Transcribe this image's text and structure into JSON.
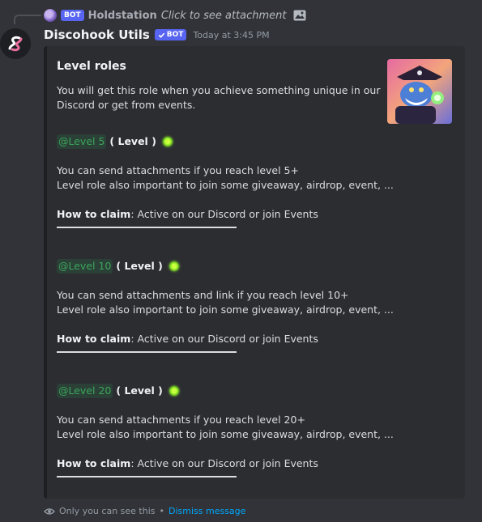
{
  "reply": {
    "bot_tag": "BOT",
    "author": "Holdstation",
    "text": "Click to see attachment"
  },
  "message": {
    "author": "Discohook Utils",
    "bot_tag": "BOT",
    "timestamp": "Today at 3:45 PM"
  },
  "embed": {
    "title": "Level roles",
    "description_1": "You will get this role when you achieve something unique in our",
    "description_2": "Discord or get from events.",
    "sections": [
      {
        "mention": "@Level 5",
        "role_tag": "( Level )",
        "line1": "You can send attachments if you reach level 5+",
        "line2": "Level role also important to join some giveaway, airdrop, event, ...",
        "claim_label": "How to claim",
        "claim_text": ": Active on our Discord or join Events"
      },
      {
        "mention": "@Level 10",
        "role_tag": "( Level )",
        "line1": "You can send attachments and link if you reach level 10+",
        "line2": "Level role also important to join some giveaway, airdrop, event, ...",
        "claim_label": "How to claim",
        "claim_text": ": Active on our Discord or join Events"
      },
      {
        "mention": "@Level 20",
        "role_tag": "( Level )",
        "line1": "You can send attachments if you reach level 20+",
        "line2": "Level role also important to join some giveaway, airdrop, event, ...",
        "claim_label": "How to claim",
        "claim_text": ": Active on our Discord or join Events"
      }
    ]
  },
  "footer": {
    "notice": "Only you can see this",
    "separator": "•",
    "dismiss": "Dismiss message"
  },
  "colors": {
    "background": "#313338",
    "embed_bg": "#2b2d31",
    "mention": "#3ba55c",
    "bot_tag": "#5865f2",
    "link": "#00a8fc"
  }
}
